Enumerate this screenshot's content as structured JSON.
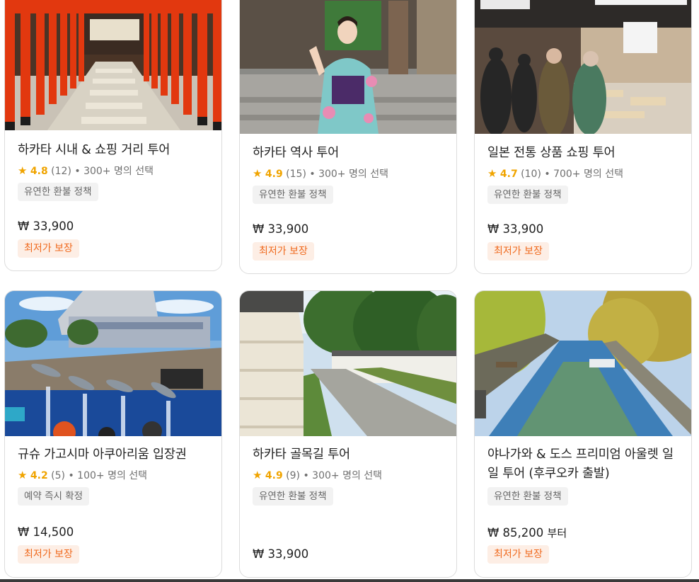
{
  "cards": [
    {
      "title": "하카타 시내 & 쇼핑 거리 투어",
      "star": "★",
      "rating": "4.8",
      "reviews": "(12)",
      "bookings": "• 300+ 명의 선택",
      "badge": "유연한 환불 정책",
      "price": "₩ 33,900",
      "price_suffix": "",
      "tag": "최저가 보장"
    },
    {
      "title": "하카타 역사 투어",
      "star": "★",
      "rating": "4.9",
      "reviews": "(15)",
      "bookings": "• 300+ 명의 선택",
      "badge": "유연한 환불 정책",
      "price": "₩ 33,900",
      "price_suffix": "",
      "tag": "최저가 보장"
    },
    {
      "title": "일본 전통 상품 쇼핑 투어",
      "star": "★",
      "rating": "4.7",
      "reviews": "(10)",
      "bookings": "• 700+ 명의 선택",
      "badge": "유연한 환불 정책",
      "price": "₩ 33,900",
      "price_suffix": "",
      "tag": "최저가 보장"
    },
    {
      "title": "규슈 가고시마 아쿠아리움 입장권",
      "star": "★",
      "rating": "4.2",
      "reviews": "(5)",
      "bookings": "• 100+ 명의 선택",
      "badge": "예약 즉시 확정",
      "price": "₩ 14,500",
      "price_suffix": "",
      "tag": "최저가 보장"
    },
    {
      "title": "하카타 골목길 투어",
      "star": "★",
      "rating": "4.9",
      "reviews": "(9)",
      "bookings": "• 300+ 명의 선택",
      "badge": "유연한 환불 정책",
      "price": "₩ 33,900",
      "price_suffix": "",
      "tag": ""
    },
    {
      "title": "야나가와 & 도스 프리미엄 아울렛 일일 투어 (후쿠오카 출발)",
      "star": "",
      "rating": "",
      "reviews": "",
      "bookings": "",
      "badge": "유연한 환불 정책",
      "price": "₩ 85,200",
      "price_suffix": "부터",
      "tag": "최저가 보장"
    }
  ]
}
